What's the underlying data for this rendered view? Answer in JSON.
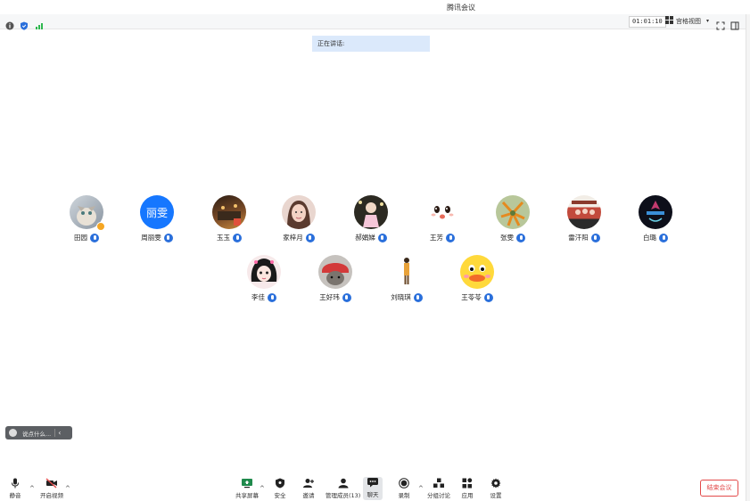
{
  "window": {
    "title": "腾讯会议"
  },
  "topbar": {
    "timer": "01:01:10",
    "view_label": "宫格视图",
    "colors": {
      "info": "#555555",
      "shield": "#2a6fdb",
      "signal": "#2fb84f"
    }
  },
  "speaking": {
    "label": "正在讲话:"
  },
  "participants": [
    {
      "name": "田园",
      "avatar_color": "#9fa7b0"
    },
    {
      "name": "周丽雯",
      "avatar_text": "丽雯",
      "avatar_color": "#1677ff"
    },
    {
      "name": "玉玉",
      "avatar_color": "#5a3a22"
    },
    {
      "name": "家梓月",
      "avatar_color": "#d9a99a"
    },
    {
      "name": "郝娟娣",
      "avatar_color": "#3d3a2c"
    },
    {
      "name": "王芳",
      "avatar_color": "#f2f2f2"
    },
    {
      "name": "张雯",
      "avatar_color": "#8aa46a"
    },
    {
      "name": "雷汗阳",
      "avatar_color": "#c24a3c"
    },
    {
      "name": "白璐",
      "avatar_color": "#0d0f1a"
    },
    {
      "name": "李佳",
      "avatar_color": "#e8c8c8"
    },
    {
      "name": "王好玮",
      "avatar_color": "#d33a3a"
    },
    {
      "name": "刘晓琪",
      "avatar_color": "#ffffff"
    },
    {
      "name": "王苓苓",
      "avatar_color": "#ffd93b"
    }
  ],
  "chat": {
    "placeholder": "说点什么..."
  },
  "toolbar": {
    "mute": "静音",
    "video": "开启视频",
    "share": "共享屏幕",
    "security": "安全",
    "invite": "邀请",
    "members": "管理成员(13)",
    "chat": "聊天",
    "record": "录制",
    "breakout": "分组讨论",
    "apps": "应用",
    "settings": "设置",
    "end": "结束会议"
  }
}
